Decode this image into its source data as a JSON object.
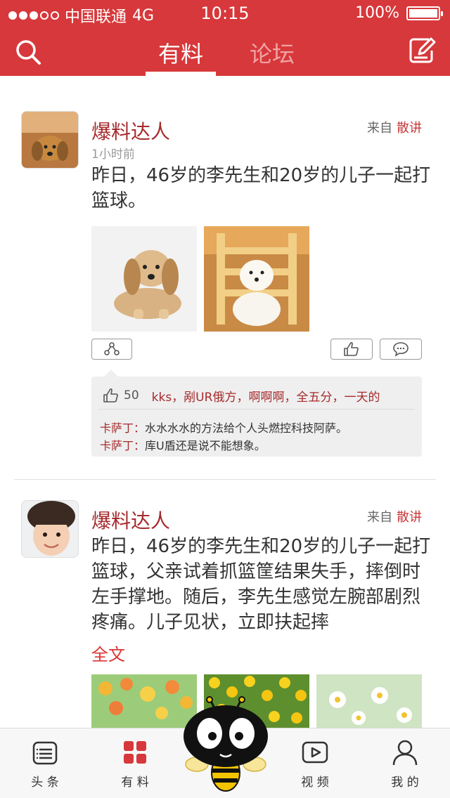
{
  "status_bar": {
    "carrier": "中国联通",
    "network": "4G",
    "time": "10:15",
    "battery": "100%",
    "signal_dots_filled": 3,
    "signal_dots_total": 5,
    "battery_level": 1.0
  },
  "header": {
    "tabs": [
      {
        "label": "有料",
        "active": true
      },
      {
        "label": "论坛",
        "active": false
      }
    ],
    "search_icon": "search-icon",
    "edit_icon": "edit-icon",
    "accent_color": "#d7383b"
  },
  "posts": [
    {
      "username": "爆料达人",
      "source_prefix": "来自",
      "source_name": "散讲",
      "time": "1小时前",
      "text": "昨日，46岁的李先生和20岁的儿子一起打篮球。",
      "likes_count": "50",
      "like_names": "kks，剐UR俄方，啊啊啊，全五分，一天的",
      "comments": [
        {
          "author": "卡萨丁：",
          "text": "水水水水的方法给个人头燃控科技阿萨。"
        },
        {
          "author": "卡萨丁：",
          "text": "库U盾还是说不能想象。"
        }
      ]
    },
    {
      "username": "爆料达人",
      "source_prefix": "来自",
      "source_name": "散讲",
      "text": "昨日，46岁的李先生和20岁的儿子一起打篮球，父亲试着抓篮筐结果失手，摔倒时左手撑地。随后，李先生感觉左腕部剧烈疼痛。儿子见状，立即扶起摔",
      "more": "全文"
    }
  ],
  "tabbar": {
    "items": [
      {
        "label": "头 条",
        "icon": "news-list-icon"
      },
      {
        "label": "有 料",
        "icon": "grid-icon"
      },
      {
        "label": "视 频",
        "icon": "video-play-icon"
      },
      {
        "label": "我 的",
        "icon": "person-icon"
      }
    ]
  }
}
